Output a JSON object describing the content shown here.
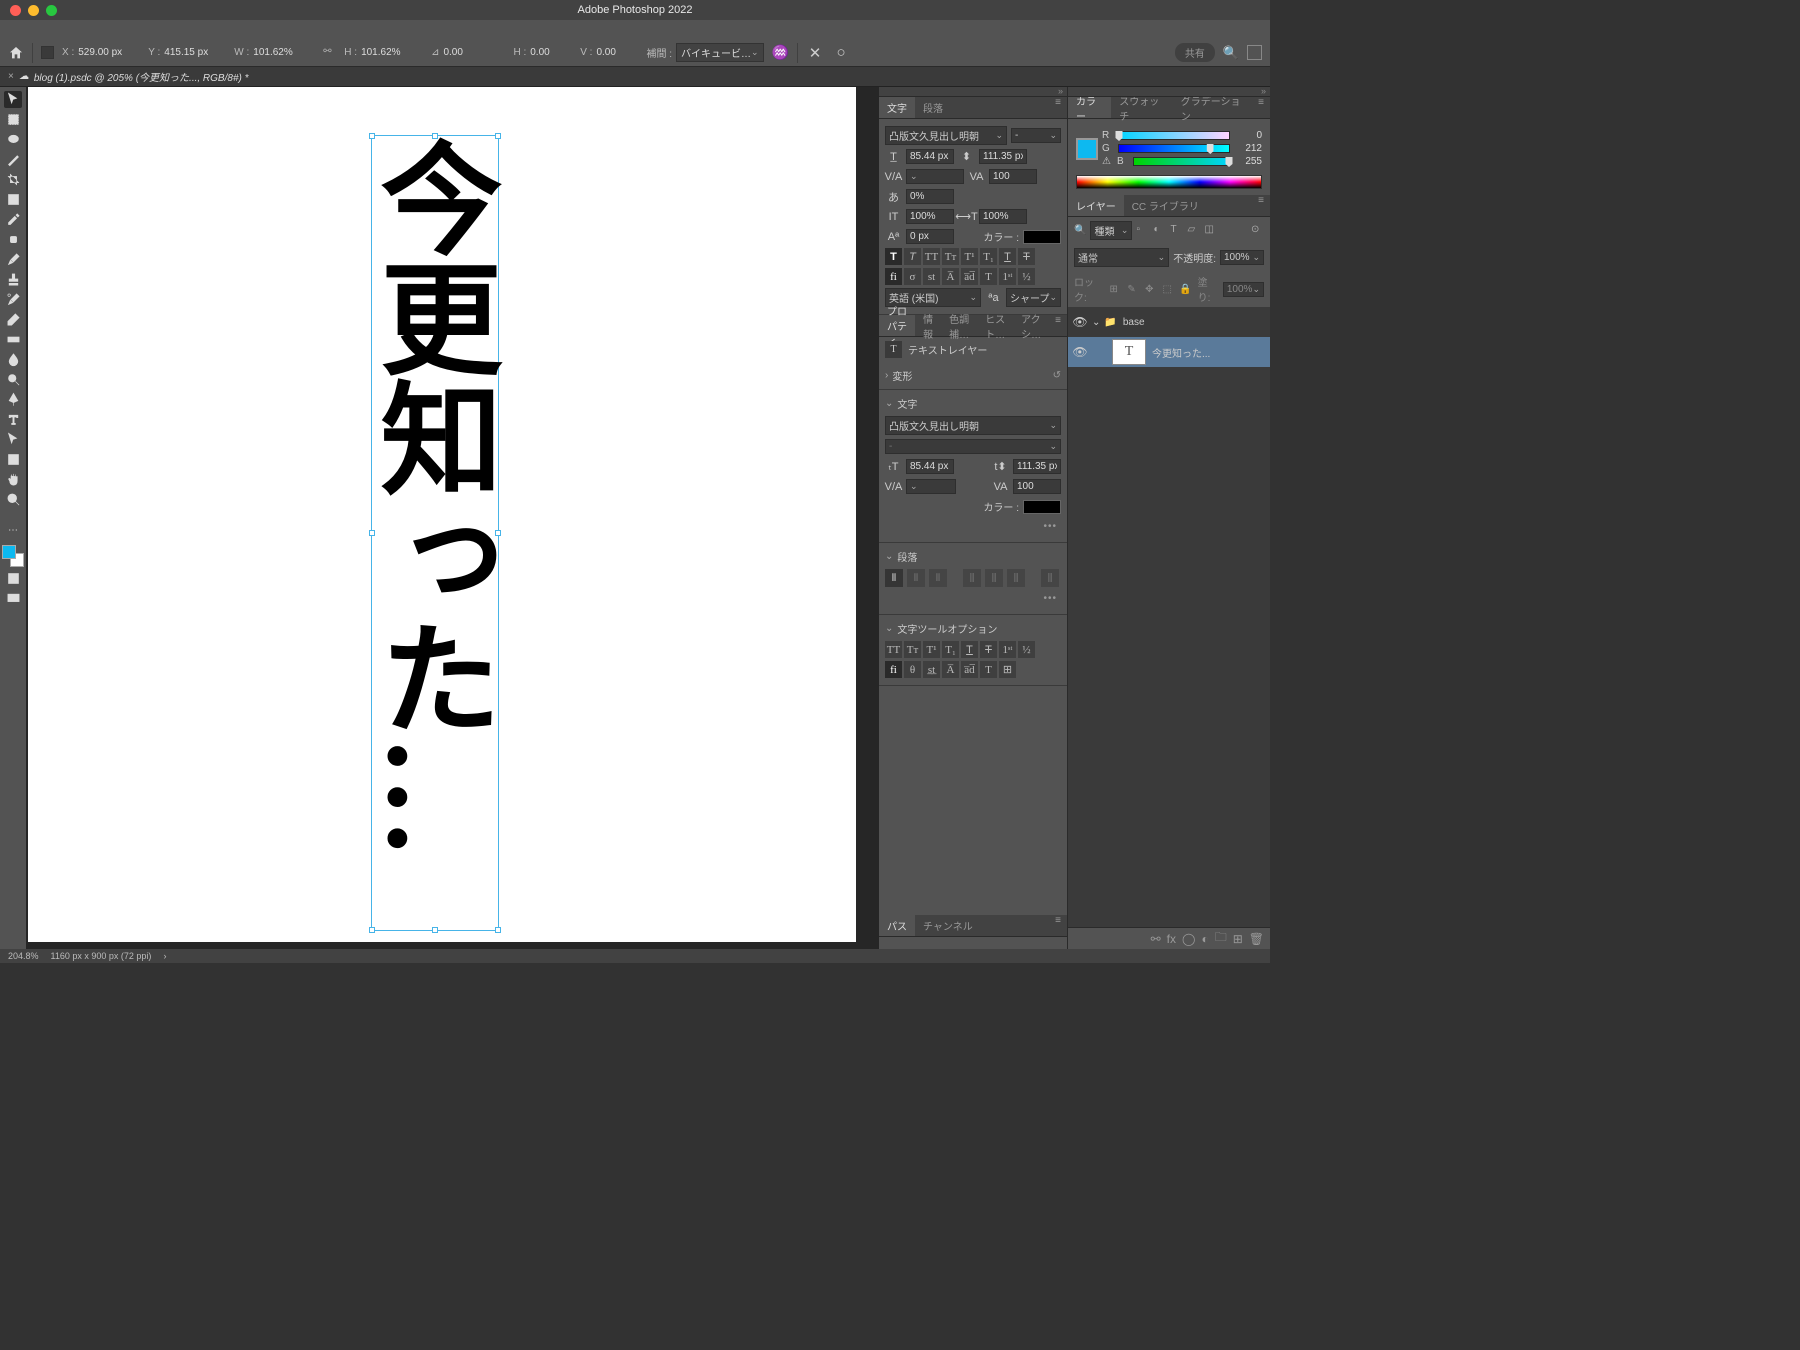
{
  "app_title": "Adobe Photoshop 2022",
  "document": {
    "close_glyph": "×",
    "cloud_glyph": "☁",
    "tab_label": "blog (1).psdc @ 205% (今更知った..., RGB/8#) *"
  },
  "options_bar": {
    "X_label": "X :",
    "X": "529.00 px",
    "Y_label": "Y :",
    "Y": "415.15 px",
    "W_label": "W :",
    "W": "101.62%",
    "H_label": "H :",
    "H": "101.62%",
    "angle_label": "⊿",
    "angle": "0.00",
    "Hskew_label": "H :",
    "Hskew": "0.00",
    "Vskew_label": "V :",
    "Vskew": "0.00",
    "interp_label": "補間 :",
    "interp": "バイキュービ…",
    "share": "共有"
  },
  "canvas_text": "今更知った…",
  "char_panel": {
    "tab_char": "文字",
    "tab_para": "段落",
    "font": "凸版文久見出し明朝",
    "style": "-",
    "size": "85.44 px",
    "leading": "111.35 px",
    "kerning": "",
    "tracking": "100",
    "vscale": "0%",
    "hscale": "100%",
    "height": "100%",
    "baseline": "0 px",
    "color_label": "カラー :",
    "lang": "英語 (米国)",
    "aa": "シャープ"
  },
  "properties": {
    "tabs": [
      "プロパティ",
      "情報",
      "色調補…",
      "ヒスト…",
      "アクシ…"
    ],
    "layer_type": "テキストレイヤー",
    "transform": "変形",
    "char": "文字",
    "font": "凸版文久見出し明朝",
    "size": "85.44 px",
    "leading": "111.35 px",
    "kerning": "",
    "tracking": "100",
    "color_label": "カラー :",
    "para": "段落",
    "textopts": "文字ツールオプション"
  },
  "paths_panel": {
    "paths": "パス",
    "channels": "チャンネル"
  },
  "color_panel": {
    "tabs": [
      "カラー",
      "スウォッチ",
      "グラデーション"
    ],
    "R": "0",
    "G": "212",
    "B": "255"
  },
  "layers_panel": {
    "tabs": [
      "レイヤー",
      "CC ライブラリ"
    ],
    "search_placeholder": "種類",
    "blend": "通常",
    "opacity_label": "不透明度:",
    "opacity": "100%",
    "lock_label": "ロック:",
    "fill_label": "塗り:",
    "fill": "100%",
    "group_name": "base",
    "layer_name": "今更知った..."
  },
  "status": {
    "zoom": "204.8%",
    "dims": "1160 px x 900 px (72 ppi)",
    "chev": "›"
  }
}
